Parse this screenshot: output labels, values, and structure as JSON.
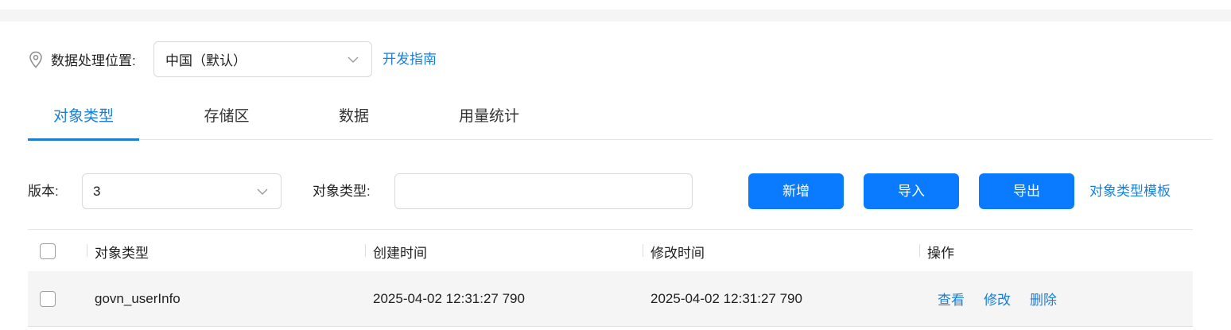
{
  "region": {
    "label": "数据处理位置:",
    "selected": "中国（默认）",
    "guide_link": "开发指南"
  },
  "tabs": [
    {
      "label": "对象类型",
      "active": true
    },
    {
      "label": "存储区",
      "active": false
    },
    {
      "label": "数据",
      "active": false
    },
    {
      "label": "用量统计",
      "active": false
    }
  ],
  "filters": {
    "version_label": "版本:",
    "version_value": "3",
    "type_label": "对象类型:",
    "type_value": "",
    "add_button": "新增",
    "import_button": "导入",
    "export_button": "导出",
    "template_link": "对象类型模板"
  },
  "table": {
    "columns": [
      "对象类型",
      "创建时间",
      "修改时间",
      "操作"
    ],
    "rows": [
      {
        "object_type": "govn_userInfo",
        "created": "2025-04-02 12:31:27 790",
        "modified": "2025-04-02 12:31:27 790",
        "actions": [
          "查看",
          "修改",
          "删除"
        ]
      }
    ]
  },
  "colors": {
    "accent": "#1a7fd9",
    "button": "#0a7bff",
    "row_bg": "#f5f5f5"
  },
  "icons": {
    "location": "location-pin-icon",
    "dropdown": "chevron-down-icon"
  }
}
